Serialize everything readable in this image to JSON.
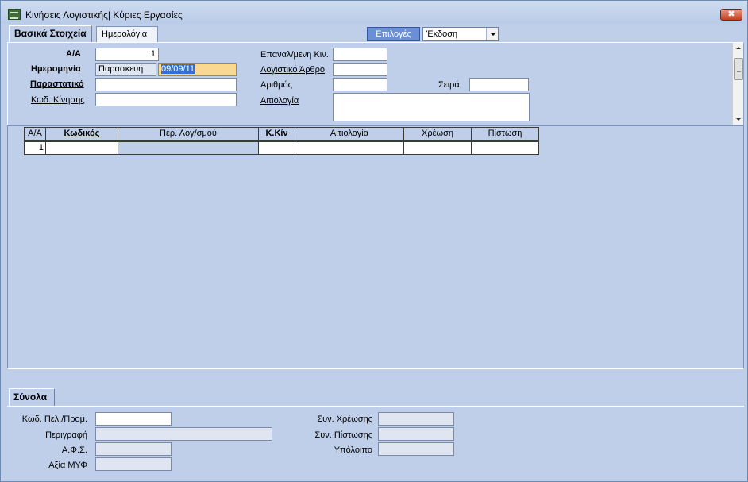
{
  "window": {
    "title": "Κινήσεις Λογιστικής| Κύριες Εργασίες",
    "close_label": "✖"
  },
  "tabs": [
    {
      "label": "Βασικά Στοιχεία",
      "active": true
    },
    {
      "label": "Ημερολόγια",
      "active": false
    }
  ],
  "toolbar": {
    "options_label": "Επιλογές",
    "version_select": "Έκδοση"
  },
  "form": {
    "aa_label": "Α/Α",
    "aa_value": "1",
    "date_label": "Ημερομηνία",
    "day_value": "Παρασκευή",
    "date_value": "09/09/11",
    "document_label": "Παραστατικό",
    "document_value": "",
    "move_code_label": "Κωδ. Κίνησης",
    "move_code_value": "",
    "repeat_label": "Επαναλ/μενη Κιν.",
    "repeat_value": "",
    "article_label": "Λογιστικό Άρθρο",
    "article_value": "",
    "number_label": "Αριθμός",
    "number_value": "",
    "series_label": "Σειρά",
    "series_value": "",
    "reason_label": "Αιτιολογία",
    "reason_value": ""
  },
  "grid": {
    "columns": [
      "Α/Α",
      "Κωδικός",
      "Περ. Λογ/σμού",
      "Κ.Κίν",
      "Αιτιολογία",
      "Χρέωση",
      "Πίστωση"
    ],
    "rows": [
      [
        "1",
        "",
        "",
        "",
        "",
        "",
        ""
      ]
    ]
  },
  "summary": {
    "tab_label": "Σύνολα",
    "customer_code_label": "Κωδ. Πελ./Προμ.",
    "customer_code_value": "",
    "description_label": "Περιγραφή",
    "description_value": "",
    "afs_label": "Α.Φ.Σ.",
    "afs_value": "",
    "myf_label": "Αξία ΜΥΦ",
    "myf_value": "",
    "total_debit_label": "Συν. Χρέωσης",
    "total_debit_value": "",
    "total_credit_label": "Συν. Πίστωσης",
    "total_credit_value": "",
    "balance_label": "Υπόλοιπο",
    "balance_value": ""
  }
}
